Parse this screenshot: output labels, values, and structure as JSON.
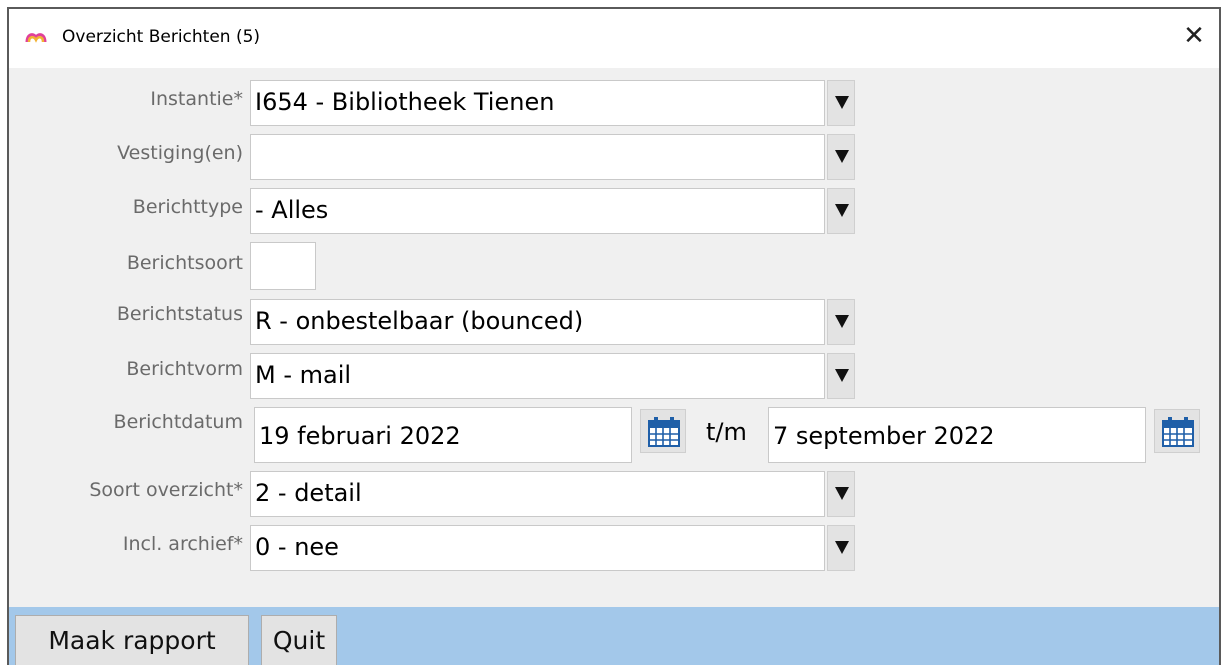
{
  "window": {
    "title": "Overzicht Berichten (5)",
    "close_label": "✕",
    "app_icon": "app-logo-icon"
  },
  "form": {
    "instantie": {
      "label": "Instantie*",
      "value": "I654 - Bibliotheek Tienen"
    },
    "vestiging": {
      "label": "Vestiging(en)",
      "value": ""
    },
    "berichttype": {
      "label": "Berichttype",
      "value": "- Alles"
    },
    "berichtsoort": {
      "label": "Berichtsoort",
      "value": ""
    },
    "berichtstatus": {
      "label": "Berichtstatus",
      "value": "R - onbestelbaar (bounced)"
    },
    "berichtvorm": {
      "label": "Berichtvorm",
      "value": "M - mail"
    },
    "berichtdatum": {
      "label": "Berichtdatum",
      "from": "19 februari 2022",
      "separator": "t/m",
      "to": "7 september 2022"
    },
    "soort_overzicht": {
      "label": "Soort overzicht*",
      "value": "2 - detail"
    },
    "incl_archief": {
      "label": "Incl. archief*",
      "value": "0 - nee"
    }
  },
  "footer": {
    "report_button": "Maak rapport",
    "quit_button": "Quit"
  },
  "colors": {
    "footer_bg": "#a3c8ea",
    "window_bg": "#f0f0f0",
    "label_color": "#6a6a6a",
    "icon_blue": "#1f5fa8"
  }
}
